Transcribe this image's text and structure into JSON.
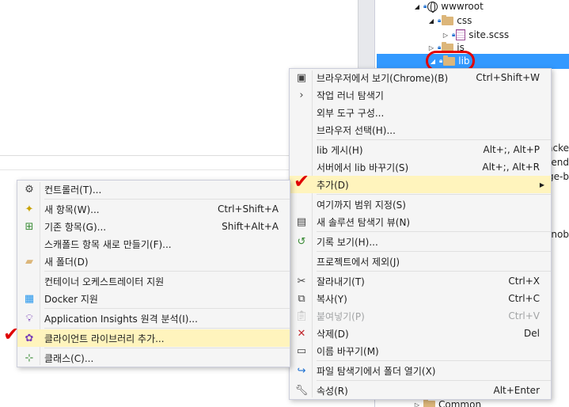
{
  "solution_tree": {
    "wwwroot": "wwwroot",
    "css": "css",
    "site_scss": "site.scss",
    "js": "js",
    "lib": "lib",
    "bottom_partial": "Common"
  },
  "side_fragments": [
    "acke",
    "end",
    "ge-b",
    "nob"
  ],
  "main_menu": {
    "items": [
      {
        "label": "브라우저에서 보기(Chrome)(B)",
        "shortcut": "Ctrl+Shift+W",
        "icon": "browser-icon"
      },
      {
        "label": "작업 러너 탐색기",
        "shortcut": "",
        "icon": "chevron-right-icon"
      },
      {
        "label": "외부 도구 구성...",
        "shortcut": "",
        "icon": ""
      },
      {
        "label": "브라우저 선택(H)...",
        "shortcut": "",
        "icon": ""
      },
      {
        "label": "lib 게시(H)",
        "shortcut": "Alt+;, Alt+P",
        "icon": ""
      },
      {
        "label": "서버에서 lib 바꾸기(S)",
        "shortcut": "Alt+;, Alt+R",
        "icon": ""
      },
      {
        "label": "추가(D)",
        "shortcut": "",
        "icon": ""
      },
      {
        "label": "여기까지 범위 지정(S)",
        "shortcut": "",
        "icon": ""
      },
      {
        "label": "새 솔루션 탐색기 뷰(N)",
        "shortcut": "",
        "icon": "new-view-icon"
      },
      {
        "label": "기록 보기(H)...",
        "shortcut": "",
        "icon": "history-icon"
      },
      {
        "label": "프로젝트에서 제외(J)",
        "shortcut": "",
        "icon": ""
      },
      {
        "label": "잘라내기(T)",
        "shortcut": "Ctrl+X",
        "icon": "cut-icon"
      },
      {
        "label": "복사(Y)",
        "shortcut": "Ctrl+C",
        "icon": "copy-icon"
      },
      {
        "label": "붙여넣기(P)",
        "shortcut": "Ctrl+V",
        "icon": "paste-icon"
      },
      {
        "label": "삭제(D)",
        "shortcut": "Del",
        "icon": "delete-icon"
      },
      {
        "label": "이름 바꾸기(M)",
        "shortcut": "",
        "icon": "rename-icon"
      },
      {
        "label": "파일 탐색기에서 폴더 열기(X)",
        "shortcut": "",
        "icon": "open-folder-icon"
      },
      {
        "label": "속성(R)",
        "shortcut": "Alt+Enter",
        "icon": "wrench-icon"
      }
    ]
  },
  "add_submenu": {
    "items": [
      {
        "label": "컨트롤러(T)...",
        "shortcut": "",
        "icon": "controller-icon"
      },
      {
        "label": "새 항목(W)...",
        "shortcut": "Ctrl+Shift+A",
        "icon": "new-item-icon"
      },
      {
        "label": "기존 항목(G)...",
        "shortcut": "Shift+Alt+A",
        "icon": "existing-item-icon"
      },
      {
        "label": "스캐폴드 항목 새로 만들기(F)...",
        "shortcut": "",
        "icon": ""
      },
      {
        "label": "새 폴더(D)",
        "shortcut": "",
        "icon": "new-folder-icon"
      },
      {
        "label": "컨테이너 오케스트레이터 지원",
        "shortcut": "",
        "icon": ""
      },
      {
        "label": "Docker 지원",
        "shortcut": "",
        "icon": "docker-icon"
      },
      {
        "label": "Application Insights 원격 분석(I)...",
        "shortcut": "",
        "icon": "insights-icon"
      },
      {
        "label": "클라이언트 라이브러리 추가...",
        "shortcut": "",
        "icon": "client-library-icon"
      },
      {
        "label": "클래스(C)...",
        "shortcut": "",
        "icon": "class-icon"
      }
    ]
  },
  "colors": {
    "highlight": "#fff4bd",
    "selection": "#3399ff",
    "annotation": "#e00000",
    "menu_bg": "#f5f5f5"
  }
}
